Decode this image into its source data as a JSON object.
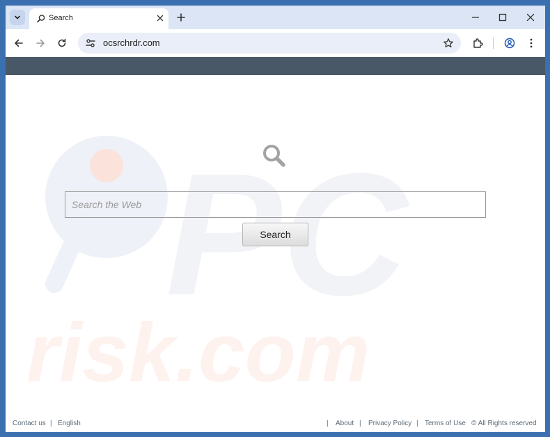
{
  "browser": {
    "tab_title": "Search",
    "url": "ocsrchrdr.com"
  },
  "page": {
    "search": {
      "placeholder": "Search the Web",
      "button_label": "Search"
    },
    "footer": {
      "contact": "Contact us",
      "divider": "|",
      "language": "English",
      "about": "About",
      "privacy": "Privacy Policy",
      "terms": "Terms of Use",
      "rights": "© All Rights reserved"
    },
    "watermark": {
      "line1": "PC",
      "line2": "risk.com"
    }
  },
  "colors": {
    "titlebar": "#dbe5f5",
    "page_header": "#485866",
    "omnibox": "#e9eef8"
  }
}
